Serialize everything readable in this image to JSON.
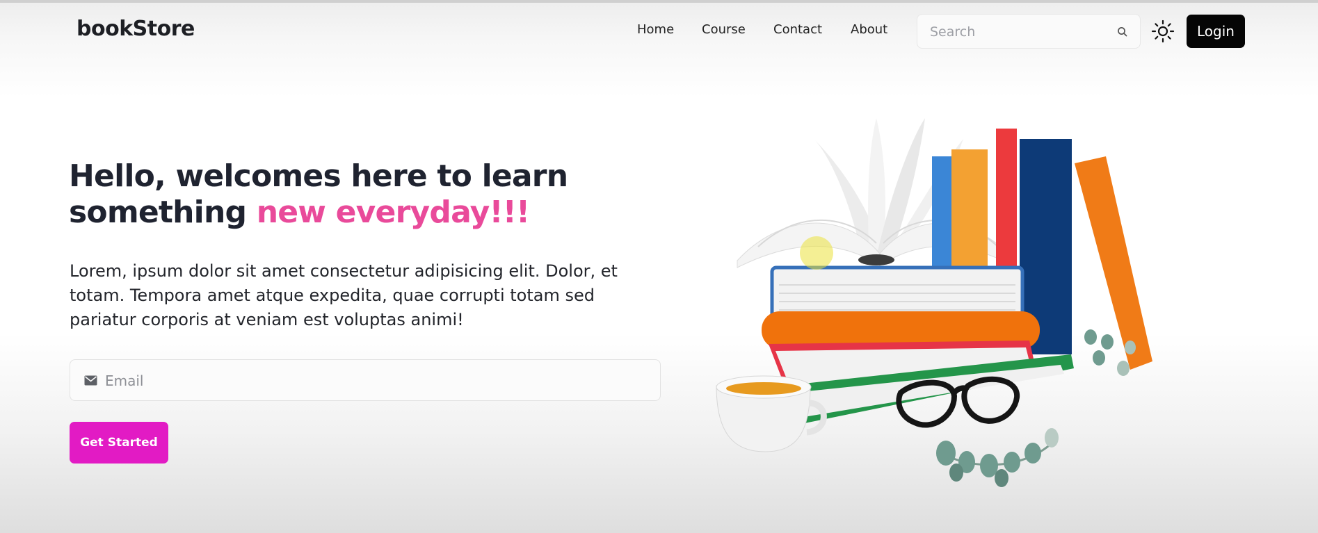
{
  "navbar": {
    "brand": "bookStore",
    "links": [
      "Home",
      "Course",
      "Contact",
      "About"
    ],
    "search_placeholder": "Search",
    "login_label": "Login"
  },
  "hero": {
    "title_main": "Hello, welcomes here to learn something ",
    "title_accent": "new everyday!!!",
    "description": "Lorem, ipsum dolor sit amet consectetur adipisicing elit. Dolor, et totam. Tempora amet atque expedita, quae corrupti totam sed pariatur corporis at veniam est voluptas animi!",
    "email_placeholder": "Email",
    "cta_label": "Get Started"
  },
  "colors": {
    "accent": "#e94a9a",
    "cta_background": "#e21bc4",
    "login_background": "#050505"
  },
  "icons": {
    "search": "search-icon",
    "theme": "sun-icon",
    "email": "envelope-icon"
  }
}
